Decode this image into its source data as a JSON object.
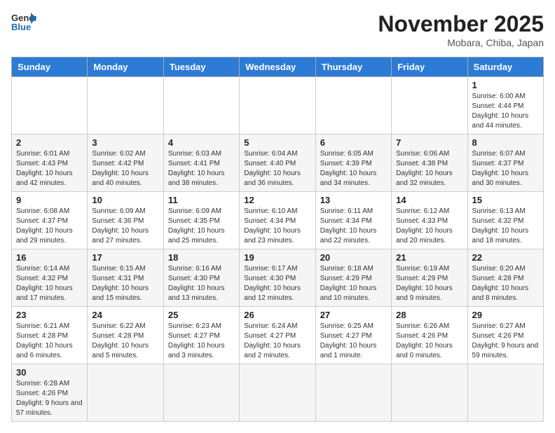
{
  "header": {
    "title": "November 2025",
    "location": "Mobara, Chiba, Japan",
    "logo_general": "General",
    "logo_blue": "Blue"
  },
  "weekdays": [
    "Sunday",
    "Monday",
    "Tuesday",
    "Wednesday",
    "Thursday",
    "Friday",
    "Saturday"
  ],
  "days": {
    "d1": {
      "num": "1",
      "info": "Sunrise: 6:00 AM\nSunset: 4:44 PM\nDaylight: 10 hours and 44 minutes."
    },
    "d2": {
      "num": "2",
      "info": "Sunrise: 6:01 AM\nSunset: 4:43 PM\nDaylight: 10 hours and 42 minutes."
    },
    "d3": {
      "num": "3",
      "info": "Sunrise: 6:02 AM\nSunset: 4:42 PM\nDaylight: 10 hours and 40 minutes."
    },
    "d4": {
      "num": "4",
      "info": "Sunrise: 6:03 AM\nSunset: 4:41 PM\nDaylight: 10 hours and 38 minutes."
    },
    "d5": {
      "num": "5",
      "info": "Sunrise: 6:04 AM\nSunset: 4:40 PM\nDaylight: 10 hours and 36 minutes."
    },
    "d6": {
      "num": "6",
      "info": "Sunrise: 6:05 AM\nSunset: 4:39 PM\nDaylight: 10 hours and 34 minutes."
    },
    "d7": {
      "num": "7",
      "info": "Sunrise: 6:06 AM\nSunset: 4:38 PM\nDaylight: 10 hours and 32 minutes."
    },
    "d8": {
      "num": "8",
      "info": "Sunrise: 6:07 AM\nSunset: 4:37 PM\nDaylight: 10 hours and 30 minutes."
    },
    "d9": {
      "num": "9",
      "info": "Sunrise: 6:08 AM\nSunset: 4:37 PM\nDaylight: 10 hours and 29 minutes."
    },
    "d10": {
      "num": "10",
      "info": "Sunrise: 6:09 AM\nSunset: 4:36 PM\nDaylight: 10 hours and 27 minutes."
    },
    "d11": {
      "num": "11",
      "info": "Sunrise: 6:09 AM\nSunset: 4:35 PM\nDaylight: 10 hours and 25 minutes."
    },
    "d12": {
      "num": "12",
      "info": "Sunrise: 6:10 AM\nSunset: 4:34 PM\nDaylight: 10 hours and 23 minutes."
    },
    "d13": {
      "num": "13",
      "info": "Sunrise: 6:11 AM\nSunset: 4:34 PM\nDaylight: 10 hours and 22 minutes."
    },
    "d14": {
      "num": "14",
      "info": "Sunrise: 6:12 AM\nSunset: 4:33 PM\nDaylight: 10 hours and 20 minutes."
    },
    "d15": {
      "num": "15",
      "info": "Sunrise: 6:13 AM\nSunset: 4:32 PM\nDaylight: 10 hours and 18 minutes."
    },
    "d16": {
      "num": "16",
      "info": "Sunrise: 6:14 AM\nSunset: 4:32 PM\nDaylight: 10 hours and 17 minutes."
    },
    "d17": {
      "num": "17",
      "info": "Sunrise: 6:15 AM\nSunset: 4:31 PM\nDaylight: 10 hours and 15 minutes."
    },
    "d18": {
      "num": "18",
      "info": "Sunrise: 6:16 AM\nSunset: 4:30 PM\nDaylight: 10 hours and 13 minutes."
    },
    "d19": {
      "num": "19",
      "info": "Sunrise: 6:17 AM\nSunset: 4:30 PM\nDaylight: 10 hours and 12 minutes."
    },
    "d20": {
      "num": "20",
      "info": "Sunrise: 6:18 AM\nSunset: 4:29 PM\nDaylight: 10 hours and 10 minutes."
    },
    "d21": {
      "num": "21",
      "info": "Sunrise: 6:19 AM\nSunset: 4:29 PM\nDaylight: 10 hours and 9 minutes."
    },
    "d22": {
      "num": "22",
      "info": "Sunrise: 6:20 AM\nSunset: 4:28 PM\nDaylight: 10 hours and 8 minutes."
    },
    "d23": {
      "num": "23",
      "info": "Sunrise: 6:21 AM\nSunset: 4:28 PM\nDaylight: 10 hours and 6 minutes."
    },
    "d24": {
      "num": "24",
      "info": "Sunrise: 6:22 AM\nSunset: 4:28 PM\nDaylight: 10 hours and 5 minutes."
    },
    "d25": {
      "num": "25",
      "info": "Sunrise: 6:23 AM\nSunset: 4:27 PM\nDaylight: 10 hours and 3 minutes."
    },
    "d26": {
      "num": "26",
      "info": "Sunrise: 6:24 AM\nSunset: 4:27 PM\nDaylight: 10 hours and 2 minutes."
    },
    "d27": {
      "num": "27",
      "info": "Sunrise: 6:25 AM\nSunset: 4:27 PM\nDaylight: 10 hours and 1 minute."
    },
    "d28": {
      "num": "28",
      "info": "Sunrise: 6:26 AM\nSunset: 4:26 PM\nDaylight: 10 hours and 0 minutes."
    },
    "d29": {
      "num": "29",
      "info": "Sunrise: 6:27 AM\nSunset: 4:26 PM\nDaylight: 9 hours and 59 minutes."
    },
    "d30": {
      "num": "30",
      "info": "Sunrise: 6:28 AM\nSunset: 4:26 PM\nDaylight: 9 hours and 57 minutes."
    }
  }
}
